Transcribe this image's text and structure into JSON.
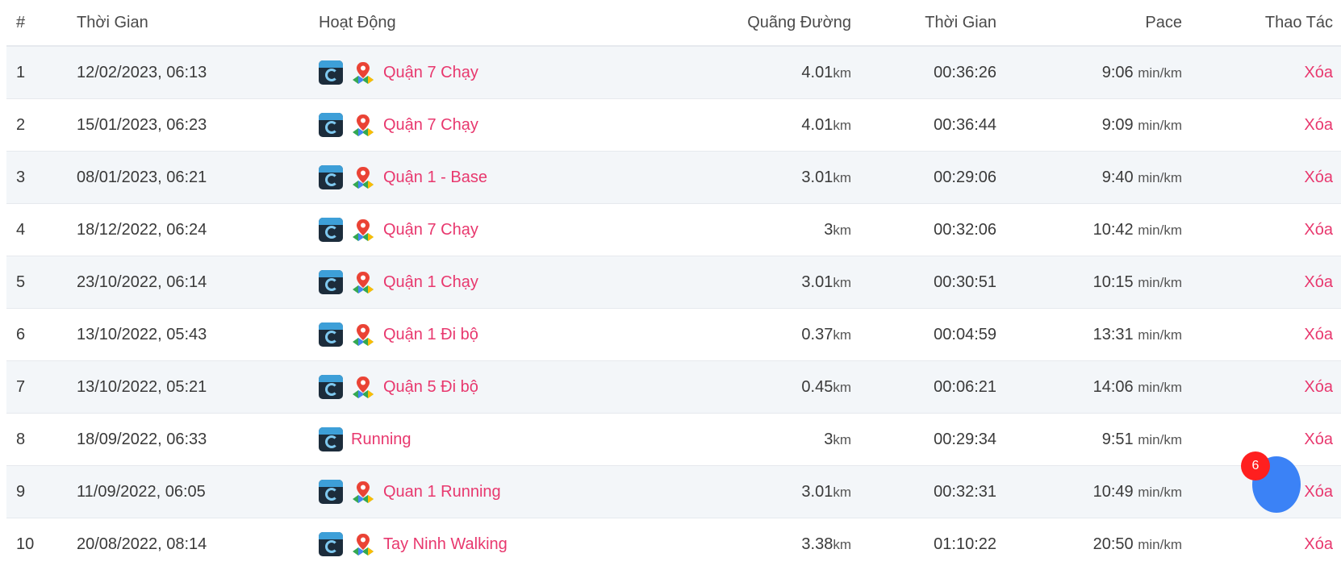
{
  "headers": {
    "num": "#",
    "time": "Thời Gian",
    "activity": "Hoạt Động",
    "distance": "Quãng Đường",
    "duration": "Thời Gian",
    "pace": "Pace",
    "action": "Thao Tác"
  },
  "units": {
    "distance": "km",
    "pace": "min/km"
  },
  "delete_label": "Xóa",
  "notification_count": "6",
  "rows": [
    {
      "num": "1",
      "time": "12/02/2023, 06:13",
      "activity": "Quận 7 Chạy",
      "has_map": true,
      "distance": "4.01",
      "duration": "00:36:26",
      "pace": "9:06"
    },
    {
      "num": "2",
      "time": "15/01/2023, 06:23",
      "activity": "Quận 7 Chạy",
      "has_map": true,
      "distance": "4.01",
      "duration": "00:36:44",
      "pace": "9:09"
    },
    {
      "num": "3",
      "time": "08/01/2023, 06:21",
      "activity": "Quận 1 - Base",
      "has_map": true,
      "distance": "3.01",
      "duration": "00:29:06",
      "pace": "9:40"
    },
    {
      "num": "4",
      "time": "18/12/2022, 06:24",
      "activity": "Quận 7 Chạy",
      "has_map": true,
      "distance": "3",
      "duration": "00:32:06",
      "pace": "10:42"
    },
    {
      "num": "5",
      "time": "23/10/2022, 06:14",
      "activity": "Quận 1 Chạy",
      "has_map": true,
      "distance": "3.01",
      "duration": "00:30:51",
      "pace": "10:15"
    },
    {
      "num": "6",
      "time": "13/10/2022, 05:43",
      "activity": "Quận 1 Đi bộ",
      "has_map": true,
      "distance": "0.37",
      "duration": "00:04:59",
      "pace": "13:31"
    },
    {
      "num": "7",
      "time": "13/10/2022, 05:21",
      "activity": "Quận 5 Đi bộ",
      "has_map": true,
      "distance": "0.45",
      "duration": "00:06:21",
      "pace": "14:06"
    },
    {
      "num": "8",
      "time": "18/09/2022, 06:33",
      "activity": "Running",
      "has_map": false,
      "distance": "3",
      "duration": "00:29:34",
      "pace": "9:51"
    },
    {
      "num": "9",
      "time": "11/09/2022, 06:05",
      "activity": "Quan 1 Running",
      "has_map": true,
      "distance": "3.01",
      "duration": "00:32:31",
      "pace": "10:49"
    },
    {
      "num": "10",
      "time": "20/08/2022, 08:14",
      "activity": "Tay Ninh Walking",
      "has_map": true,
      "distance": "3.38",
      "duration": "01:10:22",
      "pace": "20:50"
    }
  ]
}
